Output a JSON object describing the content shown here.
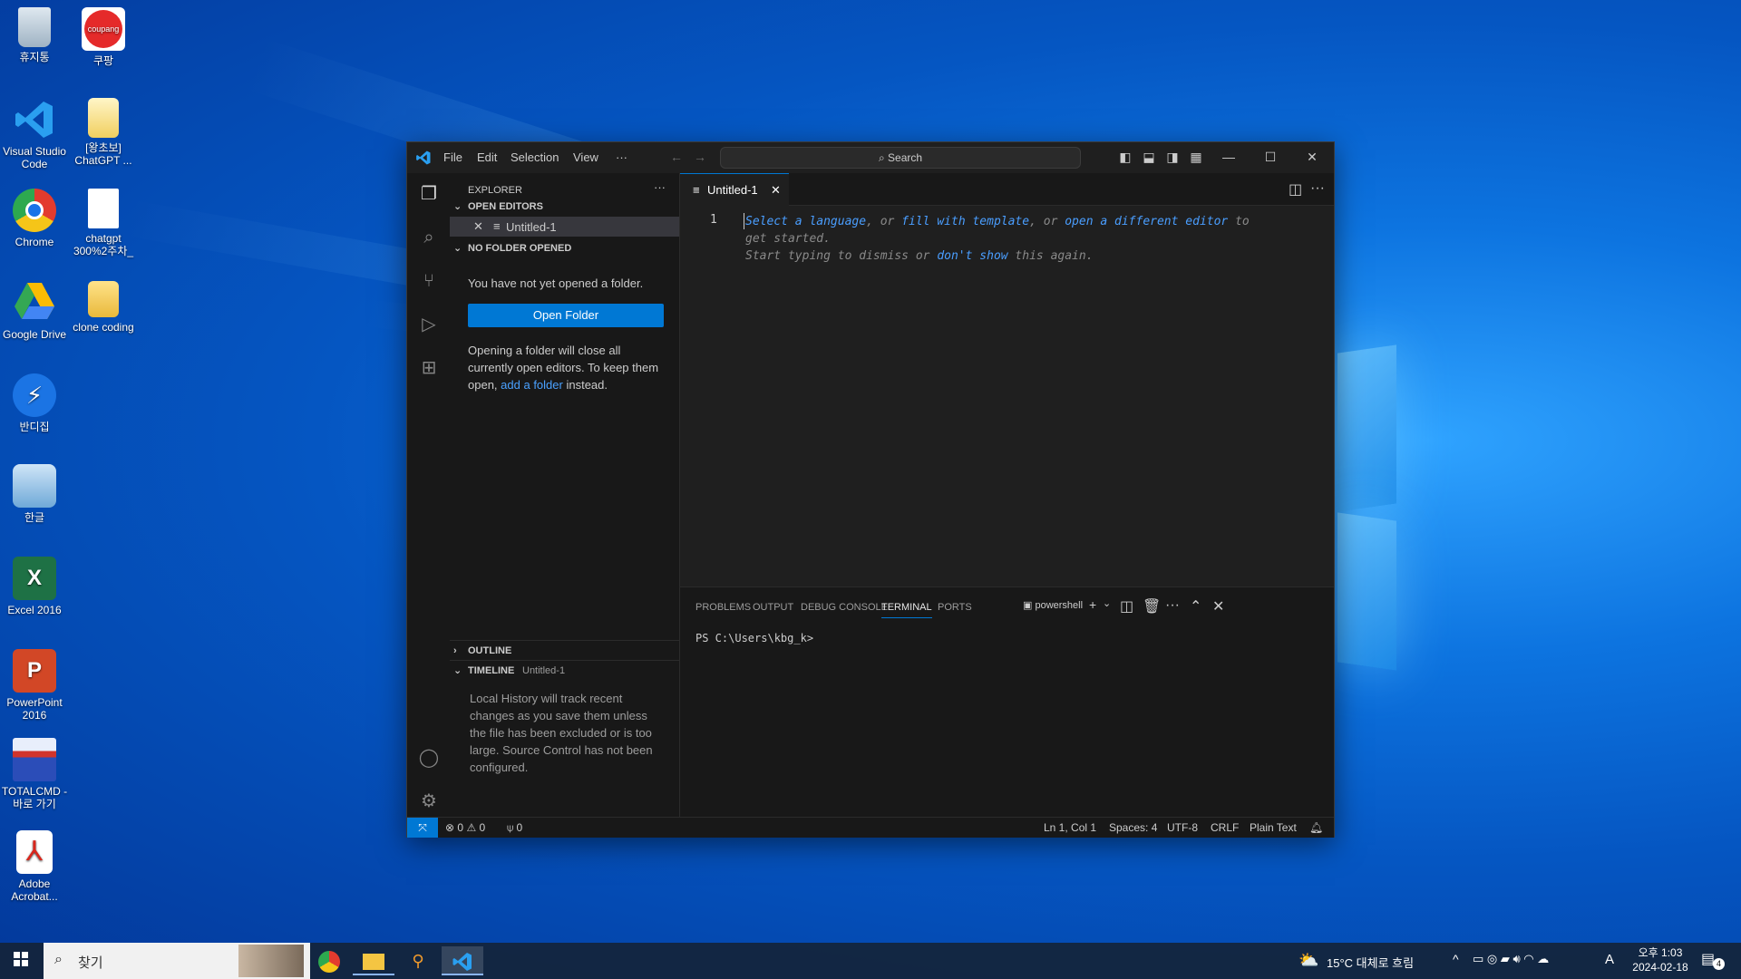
{
  "desktop": {
    "icons": [
      {
        "label": "휴지통"
      },
      {
        "label": "쿠팡",
        "badge": "coupang"
      },
      {
        "label": "Visual Studio Code"
      },
      {
        "label": "[왕초보] ChatGPT ..."
      },
      {
        "label": "Chrome"
      },
      {
        "label": "chatgpt 300%2주차_"
      },
      {
        "label": "Google Drive"
      },
      {
        "label": "clone coding"
      },
      {
        "label": "반디집"
      },
      {
        "label": "한글"
      },
      {
        "label": "Excel 2016"
      },
      {
        "label": "PowerPoint 2016"
      },
      {
        "label": "TOTALCMD - 바로 가기"
      },
      {
        "label": "Adobe Acrobat..."
      }
    ]
  },
  "vscode": {
    "menu": [
      "File",
      "Edit",
      "Selection",
      "View",
      "···"
    ],
    "search_label": "Search",
    "explorer_title": "EXPLORER",
    "open_editors": {
      "header": "OPEN EDITORS",
      "items": [
        "Untitled-1"
      ]
    },
    "no_folder": {
      "header": "NO FOLDER OPENED",
      "message": "You have not yet opened a folder.",
      "button": "Open Folder",
      "note_start": "Opening a folder will close all currently open editors. To keep them open,",
      "note_link": "add a folder",
      "note_end": "instead."
    },
    "outline": {
      "header": "OUTLINE"
    },
    "timeline": {
      "header": "TIMELINE",
      "subtitle": "Untitled-1",
      "message": "Local History will track recent changes as you save them unless the file has been excluded or is too large. Source Control has not been configured."
    },
    "editor": {
      "tab": "Untitled-1",
      "line_number": "1",
      "hint": {
        "select_language": "Select a language",
        "sep1": ", or ",
        "fill_template": "fill with template",
        "sep2": ", or ",
        "open_editor": "open a different editor",
        "to_get_started": "to",
        "line2": "get started.",
        "line3_start": "Start typing to dismiss or ",
        "dont_show": "don't show",
        "line3_end": " this again."
      }
    },
    "panel": {
      "tabs": [
        "PROBLEMS",
        "OUTPUT",
        "DEBUG CONSOLE",
        "TERMINAL",
        "PORTS"
      ],
      "active_tab": "TERMINAL",
      "shell": "powershell",
      "prompt": "PS C:\\Users\\kbg_k>"
    },
    "status": {
      "errors": "0",
      "warnings": "0",
      "ports": "0",
      "position": "Ln 1, Col 1",
      "spaces": "Spaces: 4",
      "encoding": "UTF-8",
      "eol": "CRLF",
      "language": "Plain Text"
    },
    "accent": "#0078d4"
  },
  "taskbar": {
    "search_placeholder": "찾기",
    "weather": "15°C  대체로 흐림",
    "time": "오후 1:03",
    "date": "2024-02-18",
    "ime": "A",
    "notifications": "4"
  }
}
